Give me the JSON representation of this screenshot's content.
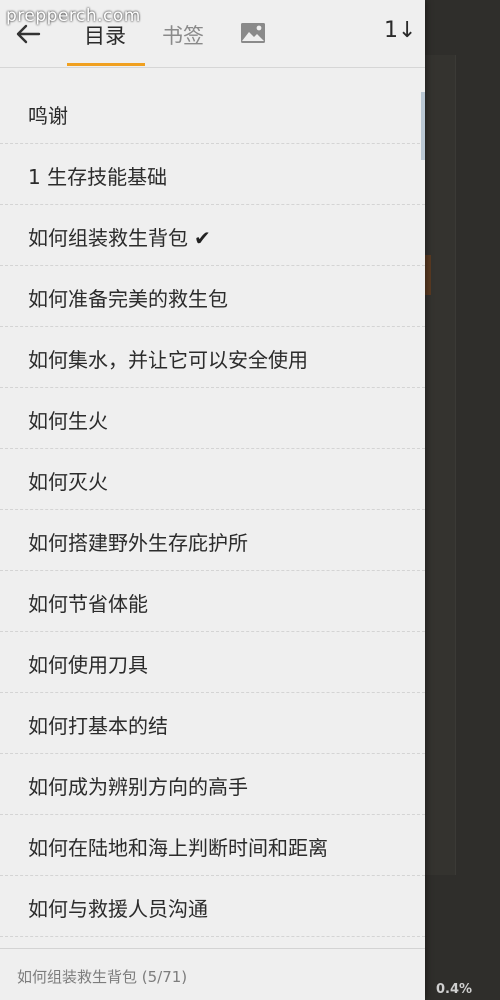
{
  "watermark": "prepperch.com",
  "header": {
    "tabs": [
      {
        "label": "目录",
        "active": true
      },
      {
        "label": "书签",
        "active": false
      }
    ],
    "image_tab_icon": "image-icon",
    "sort_label": "1↓"
  },
  "toc": {
    "items": [
      {
        "label": "鸣谢",
        "current": false
      },
      {
        "label": "1 生存技能基础",
        "current": false
      },
      {
        "label": "如何组装救生背包",
        "current": true
      },
      {
        "label": "如何准备完美的救生包",
        "current": false
      },
      {
        "label": "如何集水，并让它可以安全使用",
        "current": false
      },
      {
        "label": "如何生火",
        "current": false
      },
      {
        "label": "如何灭火",
        "current": false
      },
      {
        "label": "如何搭建野外生存庇护所",
        "current": false
      },
      {
        "label": "如何节省体能",
        "current": false
      },
      {
        "label": "如何使用刀具",
        "current": false
      },
      {
        "label": "如何打基本的结",
        "current": false
      },
      {
        "label": "如何成为辨别方向的高手",
        "current": false
      },
      {
        "label": "如何在陆地和海上判断时间和距离",
        "current": false
      },
      {
        "label": "如何与救援人员沟通",
        "current": false
      }
    ],
    "current_check": "✔"
  },
  "footer": {
    "current_chapter": "如何组装救生背包 (5/71)"
  },
  "reader": {
    "progress": "0.4%"
  },
  "colors": {
    "accent": "#f0a020",
    "drawer_bg": "#efefef",
    "overlay_bg": "#2f2e2b"
  }
}
